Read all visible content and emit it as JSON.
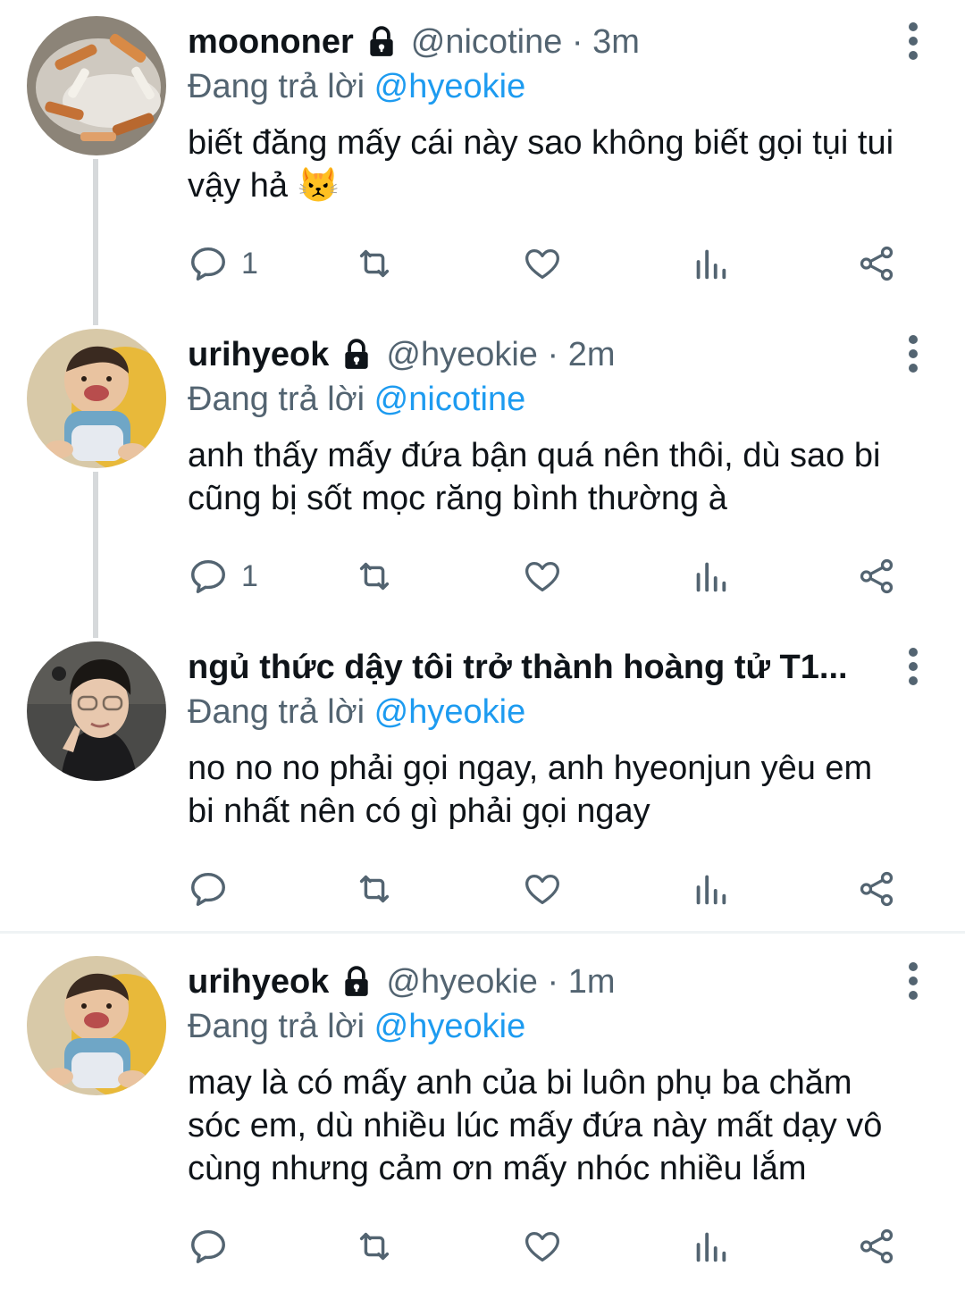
{
  "colors": {
    "accent": "#1d9bf0",
    "muted": "#536471",
    "text": "#0f1419"
  },
  "tweets": [
    {
      "name": "moononer",
      "handle": "@nicotine",
      "time": "· 3m",
      "locked": true,
      "replying_prefix": "Đang trả lời ",
      "replying_to": "@hyeokie",
      "text": "biết đăng mấy cái này sao không biết gọi tụi tui vậy hả 😾",
      "reply_count": "1",
      "avatar": "cigarette-ashtray-avatar"
    },
    {
      "name": "urihyeok",
      "handle": "@hyeokie",
      "time": "· 2m",
      "locked": true,
      "replying_prefix": "Đang trả lời ",
      "replying_to": "@nicotine",
      "text": "anh thấy mấy đứa bận quá nên thôi, dù sao bi cũng bị sốt mọc răng bình thường à",
      "reply_count": "1",
      "avatar": "baby-avatar"
    },
    {
      "name": "ngủ thức dậy tôi trở thành hoàng tử T1...",
      "handle": "",
      "time": "",
      "locked": false,
      "replying_prefix": "Đang trả lời ",
      "replying_to": "@hyeokie",
      "text": "no no no phải gọi ngay, anh hyeonjun yêu em bi nhất nên có gì phải gọi ngay",
      "reply_count": "",
      "avatar": "person-avatar"
    },
    {
      "name": "urihyeok",
      "handle": "@hyeokie",
      "time": "· 1m",
      "locked": true,
      "replying_prefix": "Đang trả lời ",
      "replying_to": "@hyeokie",
      "text": "may là có mấy anh của bi luôn phụ ba chăm sóc em, dù nhiều lúc mấy đứa này mất dạy vô cùng nhưng cảm ơn mấy nhóc nhiều lắm",
      "reply_count": "",
      "avatar": "baby-avatar"
    }
  ]
}
